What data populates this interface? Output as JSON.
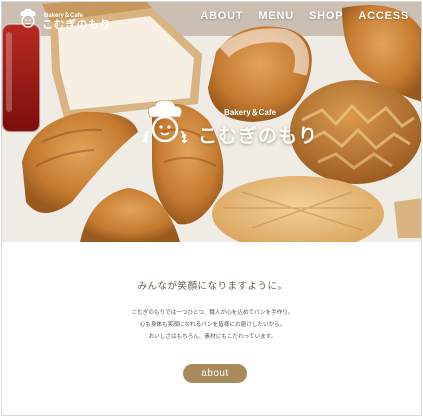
{
  "header": {
    "logo_small": "Bakery＆Cafe",
    "logo_main": "こむぎのもり",
    "nav": [
      {
        "label": "ABOUT"
      },
      {
        "label": "MENU"
      },
      {
        "label": "SHOP"
      },
      {
        "label": "ACCESS"
      }
    ]
  },
  "hero": {
    "logo_small": "Bakery＆Cafe",
    "logo_main": "こむぎのもり",
    "images": [
      "strawberry-jam-jar",
      "shokupan-bread",
      "french-bread",
      "tiger-bread",
      "croissant",
      "melon-pan"
    ]
  },
  "content": {
    "tagline": "みんなが笑顔になりますように。",
    "description": [
      "こむぎのもりでは一つひとつ、職人が心を込めてパンを手作り。",
      "心も身体も笑顔になれるパンを皆様にお届けしたいから。",
      "おいしさはもちろん、素材にもこだわっています。"
    ],
    "about_button": "about"
  },
  "colors": {
    "accent": "#a88a5c",
    "text_brown": "#6b5b4b"
  }
}
